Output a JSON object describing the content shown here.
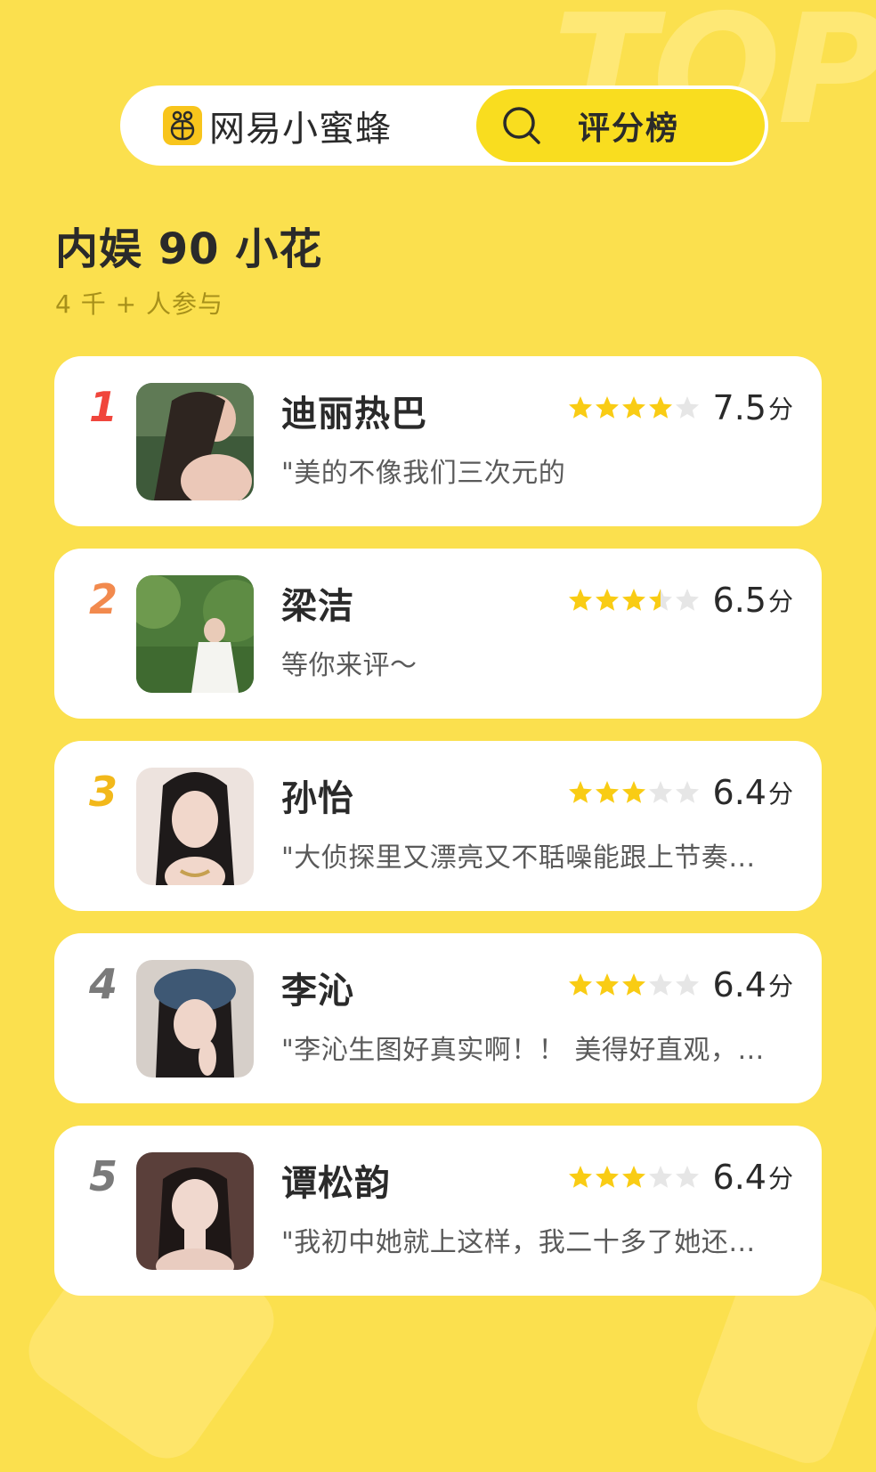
{
  "header": {
    "brand_name": "网易小蜜蜂",
    "search_label": "评分榜"
  },
  "page": {
    "title": "内娱 90 小花",
    "participants": "4 千 + 人参与"
  },
  "colors": {
    "background": "#FBE04E",
    "accent": "#F9DD1F",
    "star_on": "#F9CC14",
    "star_off": "#E6E6E6",
    "rank_1": "#F0463C",
    "rank_2": "#F28A4E",
    "rank_3": "#F2B81A",
    "rank_other": "#7A7A7A"
  },
  "ranking": [
    {
      "rank": "1",
      "name": "迪丽热巴",
      "stars": 4,
      "score": "7.5",
      "unit": "分",
      "comment": "\"美的不像我们三次元的"
    },
    {
      "rank": "2",
      "name": "梁洁",
      "stars": 3.5,
      "score": "6.5",
      "unit": "分",
      "comment": "等你来评～"
    },
    {
      "rank": "3",
      "name": "孙怡",
      "stars": 3,
      "score": "6.4",
      "unit": "分",
      "comment": "\"大侦探里又漂亮又不聒噪能跟上节奏…"
    },
    {
      "rank": "4",
      "name": "李沁",
      "stars": 3,
      "score": "6.4",
      "unit": "分",
      "comment": "\"李沁生图好真实啊！！ 美得好直观，…"
    },
    {
      "rank": "5",
      "name": "谭松韵",
      "stars": 3,
      "score": "6.4",
      "unit": "分",
      "comment": "\"我初中她就上这样，我二十多了她还…"
    }
  ]
}
